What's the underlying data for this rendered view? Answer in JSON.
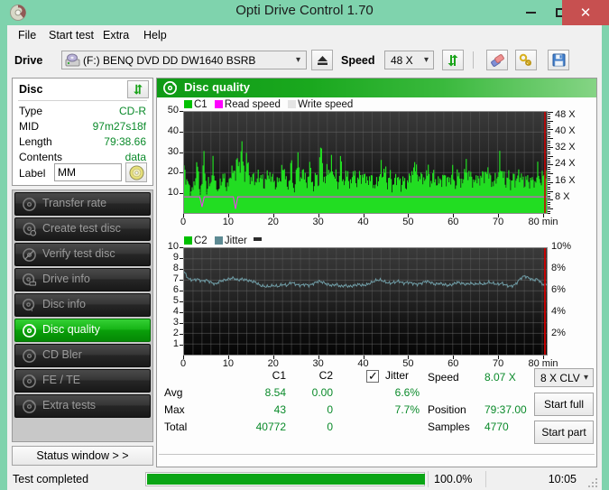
{
  "window": {
    "title": "Opti Drive Control 1.70",
    "app_icon": "disc-icon",
    "minimize": "minimize-icon",
    "maximize": "maximize-icon",
    "close": "close-icon",
    "titlebar_color": "#7fd3ad",
    "close_color": "#c75050"
  },
  "menu": [
    {
      "label": "File"
    },
    {
      "label": "Start test"
    },
    {
      "label": "Extra"
    },
    {
      "label": "Help"
    }
  ],
  "toolbar": {
    "drive_label": "Drive",
    "drive_value": "(F:)   BENQ DVD DD DW1640 BSRB",
    "drive_icon": "drive-icon",
    "eject_icon": "eject-icon",
    "speed_label": "Speed",
    "speed_value": "48 X",
    "refresh_icon": "refresh-arrows-icon",
    "erase_icon": "eraser-icon",
    "keys_icon": "keys-icon",
    "save_icon": "floppy-save-icon"
  },
  "disc_panel": {
    "title": "Disc",
    "refresh_icon": "refresh-arrows-icon",
    "rows": [
      {
        "key": "Type",
        "value": "CD-R"
      },
      {
        "key": "MID",
        "value": "97m27s18f"
      },
      {
        "key": "Length",
        "value": "79:38.66"
      },
      {
        "key": "Contents",
        "value": "data"
      }
    ],
    "label_key": "Label",
    "label_value": "MM",
    "label_placeholder": "",
    "label_button_icon": "cd-disc-icon"
  },
  "nav": {
    "items": [
      {
        "label": "Transfer rate",
        "icon": "disc-icon",
        "active": false
      },
      {
        "label": "Create test disc",
        "icon": "disc-write-icon",
        "active": false
      },
      {
        "label": "Verify test disc",
        "icon": "disc-check-icon",
        "active": false
      },
      {
        "label": "Drive info",
        "icon": "drive-info-icon",
        "active": false
      },
      {
        "label": "Disc info",
        "icon": "disc-info-icon",
        "active": false
      },
      {
        "label": "Disc quality",
        "icon": "disc-quality-icon",
        "active": true
      },
      {
        "label": "CD Bler",
        "icon": "disc-icon",
        "active": false
      },
      {
        "label": "FE / TE",
        "icon": "disc-icon",
        "active": false
      },
      {
        "label": "Extra tests",
        "icon": "disc-icon",
        "active": false
      }
    ],
    "status_window_button": "Status window > >"
  },
  "main": {
    "header_title": "Disc quality",
    "header_icon": "disc-quality-icon"
  },
  "stats": {
    "col_headers": [
      "C1",
      "C2"
    ],
    "row_labels": [
      "Avg",
      "Max",
      "Total"
    ],
    "c1": {
      "avg": "8.54",
      "max": "43",
      "total": "40772"
    },
    "c2": {
      "avg": "0.00",
      "max": "0",
      "total": "0"
    },
    "jitter_label": "Jitter",
    "jitter_checked": true,
    "jitter_avg": "6.6%",
    "jitter_max": "7.7%",
    "speed_label": "Speed",
    "speed_value": "8.07 X",
    "position_label": "Position",
    "position_value": "79:37.00",
    "samples_label": "Samples",
    "samples_value": "4770",
    "clv_value": "8 X CLV",
    "start_full": "Start full",
    "start_part": "Start part"
  },
  "statusbar": {
    "text": "Test completed",
    "percent_text": "100.0%",
    "percent_value": 100,
    "elapsed": "10:05"
  },
  "chart_data": [
    {
      "type": "area",
      "id": "c1-chart",
      "title": "",
      "xlabel": "min",
      "ylabel": "",
      "xlim": [
        0,
        81
      ],
      "ylim": [
        0,
        50
      ],
      "xticks": [
        0,
        10,
        20,
        30,
        40,
        50,
        60,
        70,
        80
      ],
      "xticklabels": [
        "0",
        "10",
        "20",
        "30",
        "40",
        "50",
        "60",
        "70",
        "80 min"
      ],
      "yticks": [
        10,
        20,
        30,
        40,
        50
      ],
      "yticklabels": [
        "10",
        "20",
        "30",
        "40",
        "50"
      ],
      "y2lim": [
        0,
        50
      ],
      "y2ticks": [
        8,
        16,
        24,
        32,
        40,
        48
      ],
      "y2ticklabels": [
        "8 X",
        "16 X",
        "24 X",
        "32 X",
        "40 X",
        "48 X"
      ],
      "grid": true,
      "legend": [
        {
          "name": "C1",
          "color": "#00c000"
        },
        {
          "name": "Read speed",
          "color": "#ff00ff"
        },
        {
          "name": "Write speed",
          "color": "#e0e0e0"
        }
      ],
      "legend_position": "top-left",
      "series": [
        {
          "name": "C1",
          "color": "#22dd22",
          "kind": "bars",
          "x": [
            0,
            0.5,
            1,
            1.5,
            2,
            2.5,
            3,
            3.5,
            4,
            4.5,
            5,
            5.5,
            6,
            6.5,
            7,
            7.5,
            8,
            8.5,
            9,
            9.5,
            10,
            10.5,
            11,
            11.5,
            12,
            12.5,
            13,
            13.5,
            14,
            14.5,
            15,
            15.5,
            16,
            16.5,
            17,
            17.5,
            18,
            18.5,
            19,
            19.5,
            20,
            20.5,
            21,
            21.5,
            22,
            22.5,
            23,
            23.5,
            24,
            24.5,
            25,
            25.5,
            26,
            26.5,
            27,
            27.5,
            28,
            28.5,
            29,
            29.5,
            30,
            30.5,
            31,
            31.5,
            32,
            32.5,
            33,
            33.5,
            34,
            34.5,
            35,
            35.5,
            36,
            36.5,
            37,
            37.5,
            38,
            38.5,
            39,
            39.5,
            40,
            40.5,
            41,
            41.5,
            42,
            42.5,
            43,
            43.5,
            44,
            44.5,
            45,
            45.5,
            46,
            46.5,
            47,
            47.5,
            48,
            48.5,
            49,
            49.5,
            50,
            50.5,
            51,
            51.5,
            52,
            52.5,
            53,
            53.5,
            54,
            54.5,
            55,
            55.5,
            56,
            56.5,
            57,
            57.5,
            58,
            58.5,
            59,
            59.5,
            60,
            60.5,
            61,
            61.5,
            62,
            62.5,
            63,
            63.5,
            64,
            64.5,
            65,
            65.5,
            66,
            66.5,
            67,
            67.5,
            68,
            68.5,
            69,
            69.5,
            70,
            70.5,
            71,
            71.5,
            72,
            72.5,
            73,
            73.5,
            74,
            74.5,
            75,
            75.5,
            76,
            76.5,
            77,
            77.5,
            78,
            78.5,
            79,
            79.5,
            80
          ],
          "values": [
            31,
            18,
            22,
            12,
            15,
            25,
            30,
            14,
            19,
            37,
            12,
            22,
            16,
            35,
            20,
            11,
            24,
            17,
            28,
            15,
            19,
            26,
            30,
            22,
            39,
            30,
            40,
            26,
            33,
            27,
            21,
            24,
            18,
            27,
            20,
            25,
            17,
            22,
            30,
            19,
            24,
            16,
            22,
            20,
            33,
            24,
            18,
            21,
            30,
            15,
            21,
            38,
            20,
            27,
            24,
            18,
            30,
            22,
            17,
            24,
            19,
            43,
            26,
            21,
            29,
            24,
            37,
            20,
            25,
            18,
            32,
            23,
            20,
            27,
            18,
            22,
            27,
            19,
            24,
            21,
            29,
            18,
            25,
            20,
            23,
            16,
            21,
            18,
            34,
            22,
            28,
            19,
            24,
            17,
            22,
            20,
            26,
            15,
            23,
            18,
            20,
            22,
            30,
            26,
            32,
            20,
            25,
            21,
            24,
            28,
            19,
            25,
            20,
            23,
            18,
            22,
            26,
            19,
            24,
            20,
            27,
            17,
            25,
            21,
            23,
            19,
            36,
            22,
            26,
            18,
            24,
            20,
            22,
            27,
            19,
            34,
            21,
            25,
            17,
            23,
            20,
            38,
            22,
            26,
            18,
            24,
            20,
            23,
            19,
            27,
            21,
            25,
            18,
            22,
            20,
            24,
            17,
            23,
            27,
            19,
            25,
            21,
            28,
            20,
            24
          ]
        },
        {
          "name": "Read speed",
          "color": "#ff33ff",
          "kind": "line",
          "x": [
            0,
            3.5,
            4,
            4.5,
            11,
            11.5,
            12,
            81
          ],
          "values": [
            8,
            8,
            3,
            8,
            8,
            2,
            8,
            8
          ]
        }
      ]
    },
    {
      "type": "line",
      "id": "c2-jitter-chart",
      "title": "",
      "xlabel": "min",
      "ylabel": "",
      "xlim": [
        0,
        81
      ],
      "ylim": [
        0,
        10
      ],
      "xticks": [
        0,
        10,
        20,
        30,
        40,
        50,
        60,
        70,
        80
      ],
      "xticklabels": [
        "0",
        "10",
        "20",
        "30",
        "40",
        "50",
        "60",
        "70",
        "80 min"
      ],
      "yticks": [
        1,
        2,
        3,
        4,
        5,
        6,
        7,
        8,
        9,
        10
      ],
      "yticklabels": [
        "1",
        "2",
        "3",
        "4",
        "5",
        "6",
        "7",
        "8",
        "9",
        "10"
      ],
      "y2lim": [
        0,
        10
      ],
      "y2ticks": [
        2,
        4,
        6,
        8,
        10
      ],
      "y2ticklabels": [
        "2%",
        "4%",
        "6%",
        "8%",
        "10%"
      ],
      "grid": true,
      "legend": [
        {
          "name": "C2",
          "color": "#00c000"
        },
        {
          "name": "Jitter",
          "color": "#5d8a93"
        }
      ],
      "legend_position": "top-left",
      "series": [
        {
          "name": "C2",
          "color": "#22dd22",
          "kind": "bars",
          "x": [],
          "values": []
        },
        {
          "name": "Jitter",
          "color": "#6e9aa3",
          "kind": "line",
          "x": [
            0,
            1,
            2,
            3,
            4,
            5,
            6,
            7,
            8,
            9,
            10,
            11,
            12,
            13,
            14,
            15,
            16,
            17,
            18,
            19,
            20,
            21,
            22,
            23,
            24,
            25,
            26,
            27,
            28,
            29,
            30,
            31,
            32,
            33,
            34,
            35,
            36,
            37,
            38,
            39,
            40,
            41,
            42,
            43,
            44,
            45,
            46,
            47,
            48,
            49,
            50,
            51,
            52,
            53,
            54,
            55,
            56,
            57,
            58,
            59,
            60,
            61,
            62,
            63,
            64,
            65,
            66,
            67,
            68,
            69,
            70,
            71,
            72,
            73,
            74,
            75,
            76,
            77,
            78,
            79,
            80
          ],
          "values": [
            7.8,
            7.1,
            7.0,
            7.1,
            6.9,
            7.0,
            6.8,
            6.6,
            6.9,
            7.0,
            7.1,
            7.2,
            7.0,
            7.1,
            7.0,
            6.9,
            6.8,
            6.5,
            6.4,
            6.4,
            6.5,
            6.4,
            6.6,
            6.5,
            6.8,
            6.6,
            6.5,
            6.6,
            6.5,
            6.7,
            6.9,
            6.8,
            6.6,
            6.5,
            6.6,
            6.4,
            6.5,
            6.4,
            6.5,
            6.6,
            6.5,
            6.6,
            6.8,
            7.0,
            7.0,
            6.8,
            6.7,
            6.8,
            6.9,
            6.7,
            6.8,
            6.7,
            6.6,
            6.7,
            6.9,
            6.8,
            6.6,
            6.7,
            6.6,
            6.5,
            6.6,
            6.8,
            6.7,
            6.6,
            6.7,
            6.6,
            6.7,
            6.6,
            6.8,
            6.7,
            6.6,
            6.7,
            6.5,
            6.4,
            6.6,
            7.1,
            7.4,
            7.2,
            7.0,
            7.1,
            6.6
          ]
        }
      ]
    }
  ]
}
